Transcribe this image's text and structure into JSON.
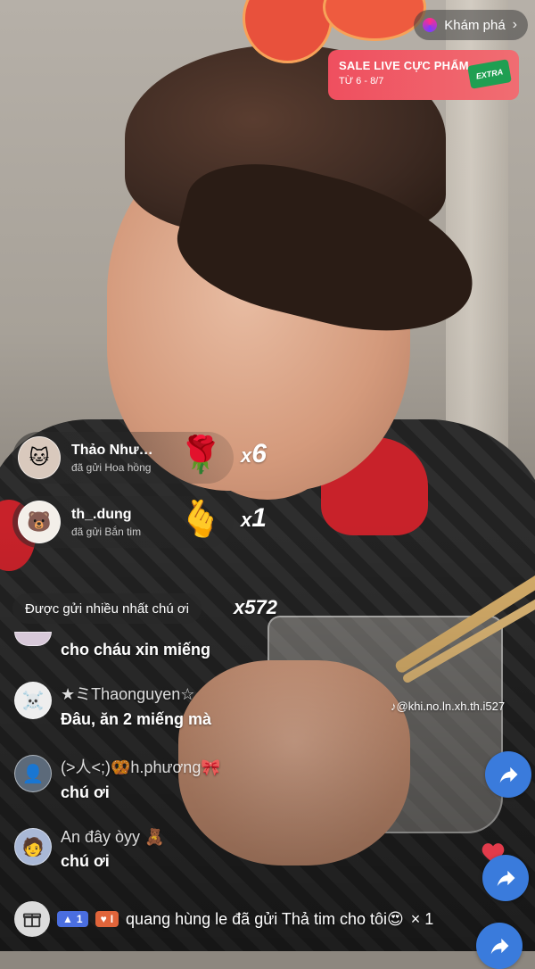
{
  "explore": {
    "label": "Khám phá",
    "chevron": "›"
  },
  "promo": {
    "title": "SALE LIVE CỰC PHẨM",
    "dates": "TỪ 6 - 8/7",
    "badge": "EXTRA"
  },
  "gifts": [
    {
      "user": "Thảo Như…",
      "action": "đã gửi Hoa hồng",
      "emoji": "🌹",
      "count": "6"
    },
    {
      "user": "th_.dung",
      "action": "đã gửi Bắn tim",
      "emoji": "🫰",
      "count": "1"
    }
  ],
  "top_sent": {
    "label": "Được gửi nhiều nhất chú ơi",
    "count": "x572"
  },
  "comments": [
    {
      "user": "",
      "message": "cho cháu xin miếng"
    },
    {
      "user": "★ミThaonguyen☆",
      "message": "Đâu, ăn 2 miếng mà"
    },
    {
      "user": "(>人<;)🥨h.phương🎀",
      "message": "chú ơi"
    },
    {
      "user": "An đây òyy 🧸",
      "message": "chú ơi"
    }
  ],
  "watermark": "@khi.no.ln.xh.th.i527",
  "bottom": {
    "level_badge": "1",
    "heart_badge": "I",
    "user": "quang hùng le",
    "message": "đã gửi Thả tim cho tôi",
    "count": "× 1"
  },
  "icons": {
    "explore": "explore-orb-icon",
    "share": "share-arrow-icon",
    "gift": "gift-box-icon",
    "heart": "heart-icon"
  },
  "colors": {
    "share_blue": "#3a7bdc",
    "promo_red": "#ef4f5f"
  }
}
